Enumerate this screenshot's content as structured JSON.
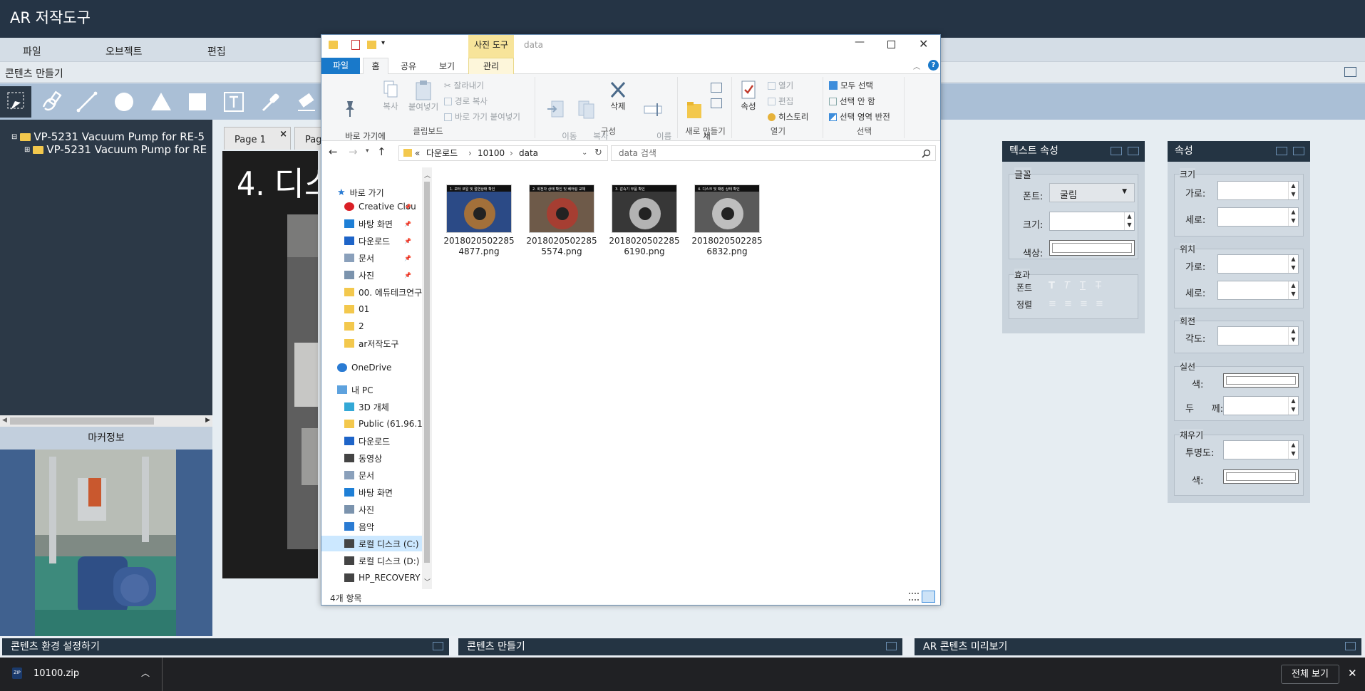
{
  "app": {
    "title": "AR 저작도구"
  },
  "menu": [
    "파일",
    "오브젝트",
    "편집"
  ],
  "section": {
    "title": "콘텐츠 만들기"
  },
  "tree": {
    "items": [
      "VP-5231 Vacuum Pump for RE-5",
      "VP-5231 Vacuum Pump for RE"
    ]
  },
  "marker": {
    "header": "마커정보"
  },
  "pages": {
    "tabs": [
      "Page 1",
      "Page"
    ],
    "close": "×"
  },
  "canvas": {
    "heading": "4. 디스크"
  },
  "text_props": {
    "title": "텍스트 속성",
    "font_group": "글꼴",
    "font_label": "폰트:",
    "font_value": "굴림",
    "size_label": "크기:",
    "color_label": "색상:",
    "effect_group": "효과",
    "effect_font_label": "폰트",
    "align_label": "정렬",
    "effect_glyphs": [
      "T",
      "T",
      "T",
      "T"
    ],
    "align_glyphs": [
      "≡",
      "≡",
      "≡",
      "≡"
    ]
  },
  "props": {
    "title": "속성",
    "size_group": "크기",
    "width_label": "가로:",
    "height_label": "세로:",
    "pos_group": "위치",
    "pos_x_label": "가로:",
    "pos_y_label": "세로:",
    "rot_group": "회전",
    "angle_label": "각도:",
    "line_group": "실선",
    "line_color_label": "색:",
    "line_thick_label": "두      께:",
    "fill_group": "채우기",
    "opacity_label": "투명도:",
    "fill_color_label": "색:"
  },
  "bottom_tabs": [
    "콘텐츠 환경 설정하기",
    "콘텐츠 만들기",
    "AR 콘텐츠 미리보기"
  ],
  "download": {
    "file": "10100.zip",
    "show_all": "전체 보기",
    "close": "✕"
  },
  "explorer": {
    "context_tab": "사진 도구",
    "window_title": "data",
    "ribbon_tabs": [
      "파일",
      "홈",
      "공유",
      "보기",
      "관리"
    ],
    "clipboard": {
      "pin": "바로 가기에\n고정",
      "copy": "복사",
      "paste": "붙여넣기",
      "cut": "잘라내기",
      "copy_path": "경로 복사",
      "paste_shortcut": "바로 가기 붙여넣기",
      "label": "클립보드"
    },
    "organize": {
      "move": "이동\n위치",
      "copyto": "복사\n위치",
      "delete": "삭제",
      "rename": "이름\n바꾸기",
      "label": "구성"
    },
    "new": {
      "folder": "새\n폴더",
      "label": "새로 만들기"
    },
    "open": {
      "properties": "속성",
      "open": "열기",
      "edit": "편집",
      "history": "히스토리",
      "label": "열기"
    },
    "select": {
      "all": "모두 선택",
      "none": "선택 안 함",
      "invert": "선택 영역 반전",
      "label": "선택"
    },
    "address": {
      "prefix": "«",
      "parts": [
        "다운로드",
        "10100",
        "data"
      ]
    },
    "search_placeholder": "data 검색",
    "nav": {
      "quick": "바로 가기",
      "quick_items": [
        "Creative Clou",
        "바탕 화면",
        "다운로드",
        "문서",
        "사진",
        "00. 에듀테크연구",
        "01",
        "2",
        "ar저작도구"
      ],
      "onedrive": "OneDrive",
      "pc": "내 PC",
      "pc_items": [
        "3D 개체",
        "Public (61.96.19",
        "다운로드",
        "동영상",
        "문서",
        "바탕 화면",
        "사진",
        "음악",
        "로컬 디스크 (C:)",
        "로컬 디스크 (D:)",
        "HP_RECOVERY ("
      ]
    },
    "files": [
      {
        "name": "20180205022854877.png",
        "line1": "2018020502285",
        "line2": "4877.png",
        "caption": "1. 모터 코일 및 절연상태 확인"
      },
      {
        "name": "20180205022855574.png",
        "line1": "2018020502285",
        "line2": "5574.png",
        "caption": "2. 회전자 상태 확인 및 베어링 교체"
      },
      {
        "name": "20180205022856190.png",
        "line1": "2018020502285",
        "line2": "6190.png",
        "caption": "3. 감속기 부품 확인"
      },
      {
        "name": "20180205022856832.png",
        "line1": "2018020502285",
        "line2": "6832.png",
        "caption": "4. 디스크 및 패킹 상태 확인"
      }
    ],
    "status": "4개 항목"
  },
  "colors": {
    "titlebar": "#253445",
    "toolbar": "#aabfd6",
    "panel_head": "#243443",
    "ribbon_file": "#1979ca",
    "context": "#f7e49a"
  }
}
